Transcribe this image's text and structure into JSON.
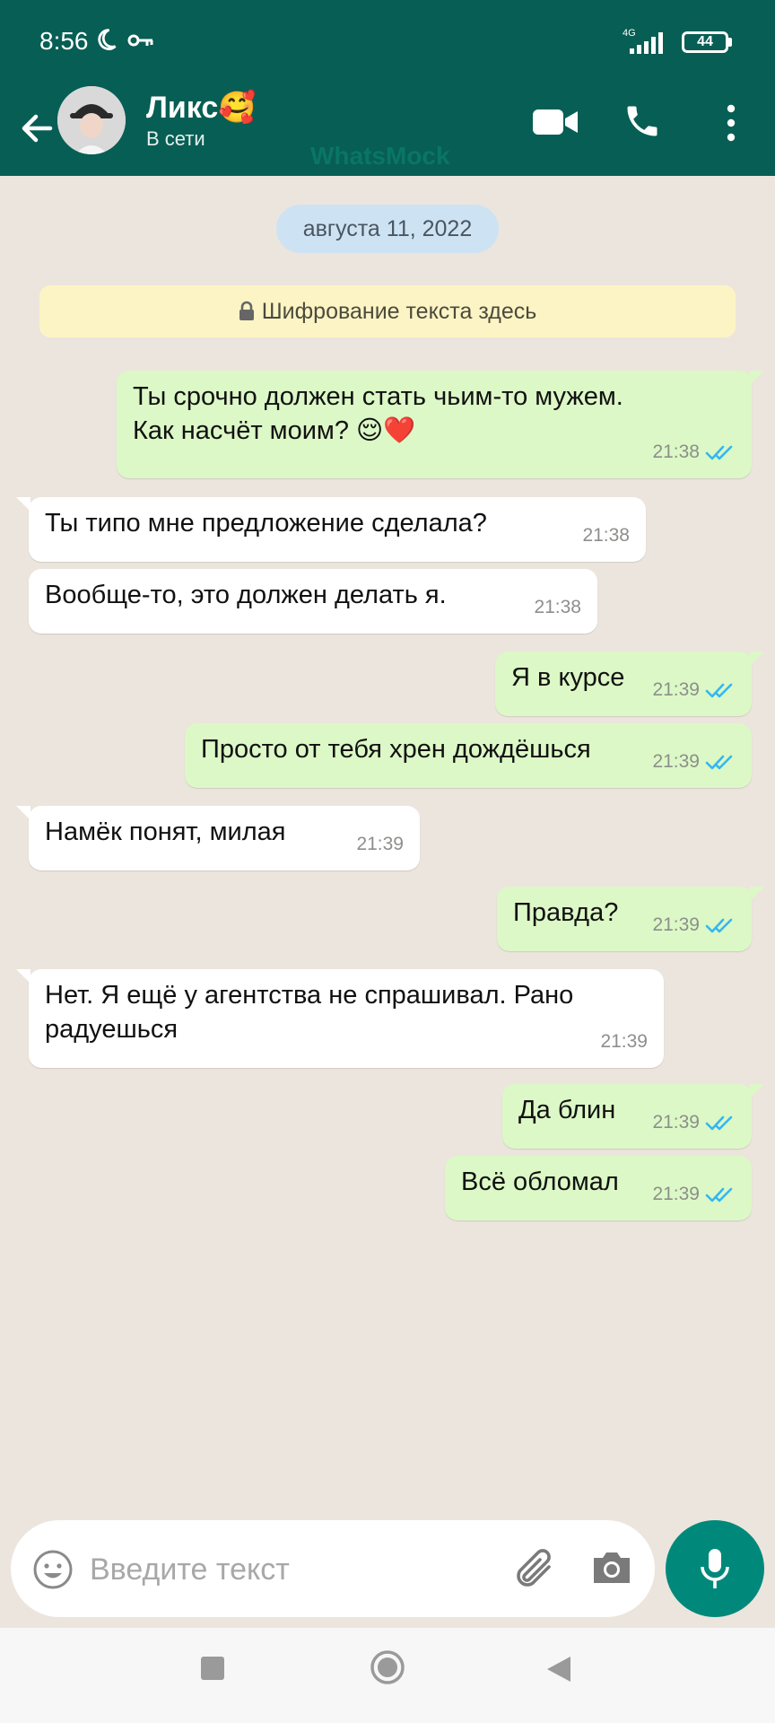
{
  "status_bar": {
    "time": "8:56",
    "network": "4G",
    "battery": "44"
  },
  "header": {
    "contact_name": "Ликс🥰",
    "contact_status": "В сети",
    "watermark": "WhatsMock"
  },
  "chat": {
    "date": "августа 11, 2022",
    "encryption_notice": "Шифрование текста здесь",
    "messages": [
      {
        "dir": "out",
        "text": "Ты срочно должен стать чьим-то мужем.\nКак насчёт моим? 😌❤️",
        "time": "21:38"
      },
      {
        "dir": "in",
        "text": "Ты типо мне предложение сделала?",
        "time": "21:38"
      },
      {
        "dir": "in",
        "text": "Вообще-то, это должен делать я.",
        "time": "21:38"
      },
      {
        "dir": "out",
        "text": "Я в курсе",
        "time": "21:39"
      },
      {
        "dir": "out",
        "text": "Просто от тебя хрен дождёшься",
        "time": "21:39"
      },
      {
        "dir": "in",
        "text": "Намёк понят, милая",
        "time": "21:39"
      },
      {
        "dir": "out",
        "text": "Правда?",
        "time": "21:39"
      },
      {
        "dir": "in",
        "text": "Нет. Я ещё у агентства не спрашивал. Рано\nрадуешься",
        "time": "21:39"
      },
      {
        "dir": "out",
        "text": "Да блин",
        "time": "21:39"
      },
      {
        "dir": "out",
        "text": "Всё обломал",
        "time": "21:39"
      }
    ]
  },
  "composer": {
    "placeholder": "Введите текст"
  },
  "colors": {
    "header": "#075E54",
    "outgoing_bubble": "#DCF8C6",
    "incoming_bubble": "#FFFFFF",
    "read_ticks": "#34B7F1",
    "mic_button": "#00897B"
  },
  "icons": [
    "back-arrow-icon",
    "video-call-icon",
    "phone-icon",
    "more-vert-icon",
    "lock-icon",
    "double-check-icon",
    "emoji-icon",
    "paperclip-icon",
    "camera-icon",
    "mic-icon"
  ]
}
